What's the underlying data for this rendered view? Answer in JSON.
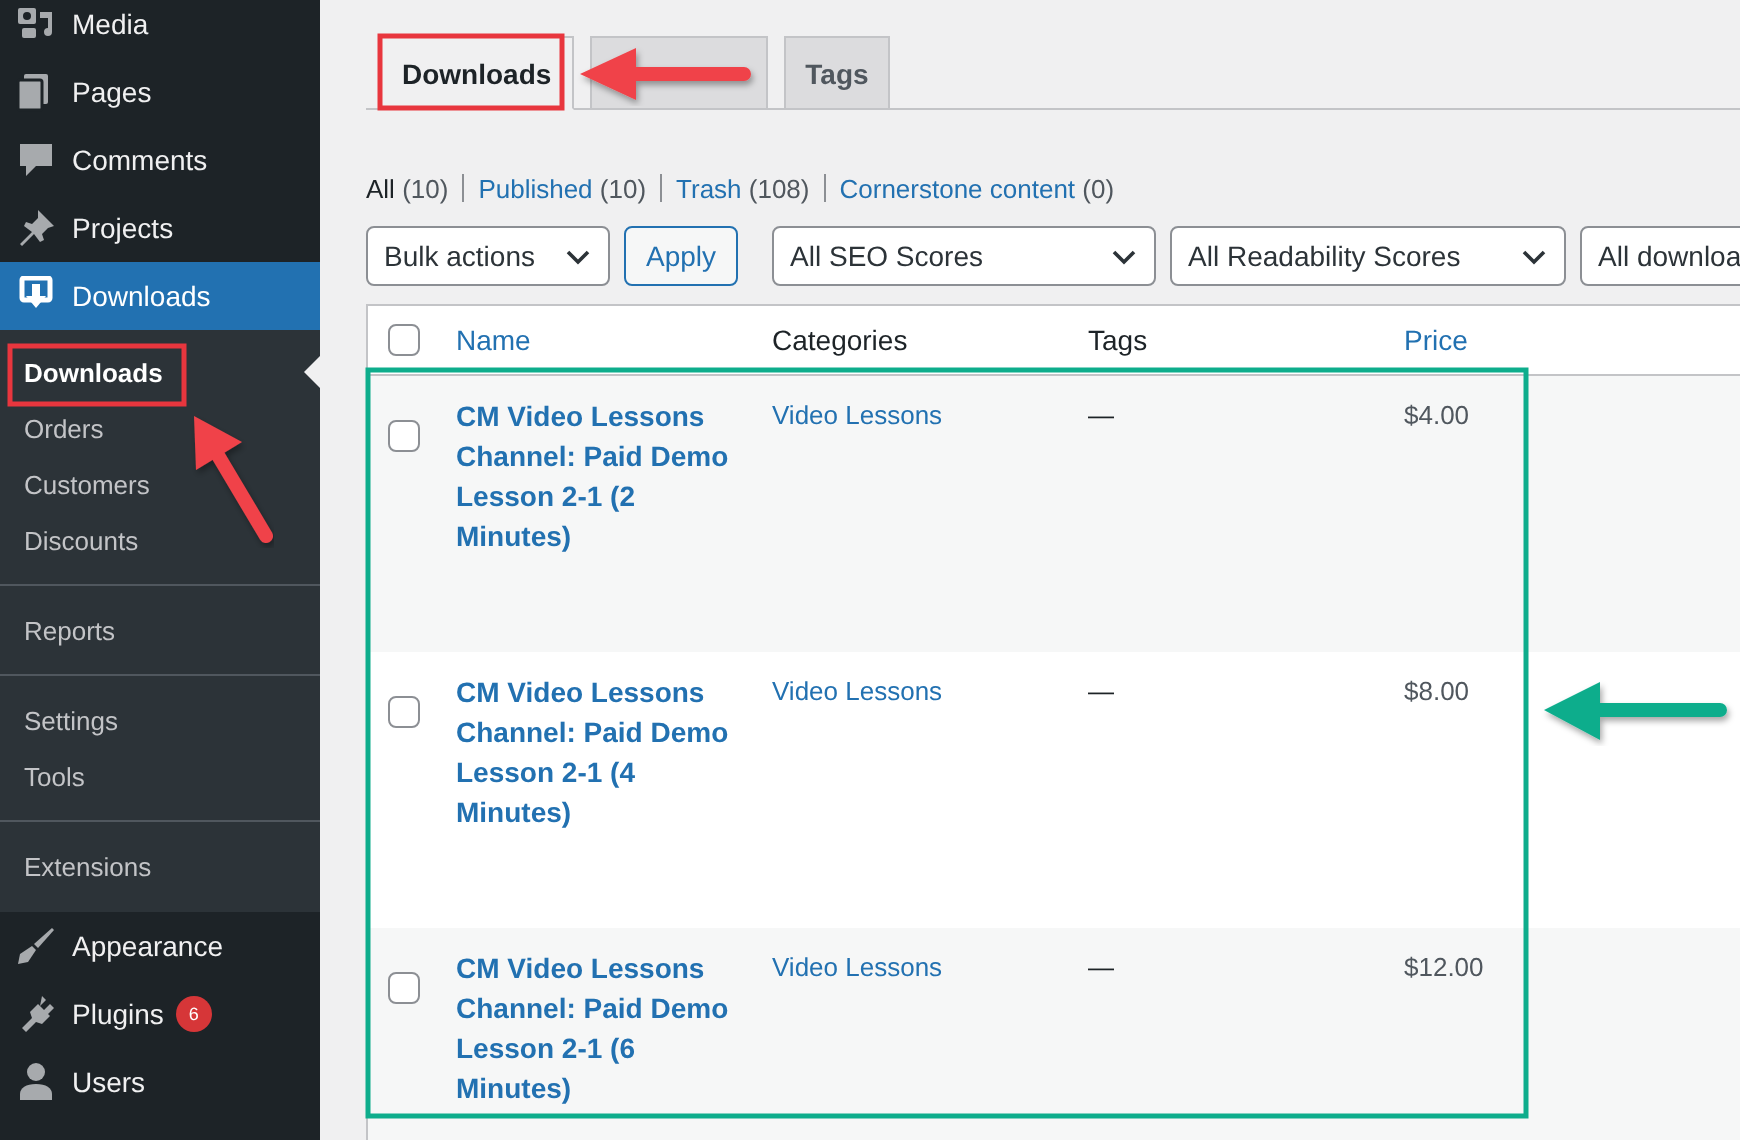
{
  "sidebar": {
    "items": [
      {
        "label": "Media",
        "selected": false
      },
      {
        "label": "Pages",
        "selected": false
      },
      {
        "label": "Comments",
        "selected": false
      },
      {
        "label": "Projects",
        "selected": false
      },
      {
        "label": "Downloads",
        "selected": true,
        "submenu_groups": [
          [
            {
              "label": "Downloads",
              "selected": true
            },
            {
              "label": "Orders",
              "selected": false
            },
            {
              "label": "Customers",
              "selected": false
            },
            {
              "label": "Discounts",
              "selected": false
            }
          ],
          [
            {
              "label": "Reports",
              "selected": false
            }
          ],
          [
            {
              "label": "Settings",
              "selected": false
            },
            {
              "label": "Tools",
              "selected": false
            }
          ],
          [
            {
              "label": "Extensions",
              "selected": false
            }
          ]
        ]
      },
      {
        "label": "Appearance",
        "selected": false
      },
      {
        "label": "Plugins",
        "selected": false,
        "badge": "6"
      },
      {
        "label": "Users",
        "selected": false
      }
    ]
  },
  "tabs": [
    {
      "label": "Downloads",
      "selected": true
    },
    {
      "selected": false
    },
    {
      "label": "Tags",
      "selected": false
    }
  ],
  "filters": [
    {
      "label": "All",
      "count": "(10)",
      "selected": true
    },
    {
      "label": "Published",
      "count": "(10)",
      "selected": false
    },
    {
      "label": "Trash",
      "count": "(108)",
      "selected": false
    },
    {
      "label": "Cornerstone content",
      "count": "(0)",
      "selected": false
    }
  ],
  "toolbar": {
    "bulk_actions": "Bulk actions",
    "apply": "Apply",
    "dropdowns": [
      "All SEO Scores",
      "All Readability Scores",
      "All downloa"
    ]
  },
  "table": {
    "select_all_checked": false,
    "columns": [
      {
        "label": "Name",
        "sortable": true
      },
      {
        "label": "Categories",
        "sortable": false
      },
      {
        "label": "Tags",
        "sortable": false
      },
      {
        "label": "Price",
        "sortable": true
      }
    ],
    "rows": [
      {
        "checked": false,
        "name": "CM Video Lessons Channel: Paid Demo Lesson 2-1 (2 Minutes)",
        "categories": "Video Lessons",
        "tags": "—",
        "price": "$4.00"
      },
      {
        "checked": false,
        "name": "CM Video Lessons Channel: Paid Demo Lesson 2-1 (4 Minutes)",
        "categories": "Video Lessons",
        "tags": "—",
        "price": "$8.00"
      },
      {
        "checked": false,
        "name": "CM Video Lessons Channel: Paid Demo Lesson 2-1 (6 Minutes)",
        "categories": "Video Lessons",
        "tags": "—",
        "price": "$12.00"
      }
    ]
  }
}
